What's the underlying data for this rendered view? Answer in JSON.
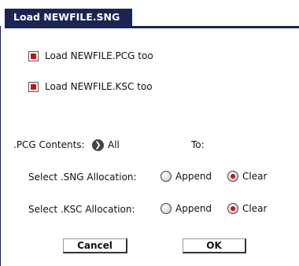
{
  "dialog": {
    "title": "Load NEWFILE.SNG"
  },
  "options": [
    {
      "label": "Load NEWFILE.PCG too",
      "checked": true
    },
    {
      "label": "Load NEWFILE.KSC too",
      "checked": true
    }
  ],
  "pcg": {
    "label": ".PCG Contents:",
    "value": "All",
    "to_label": "To:"
  },
  "sng_alloc": {
    "label": "Select .SNG Allocation:",
    "append_label": "Append",
    "clear_label": "Clear",
    "selected": "Clear"
  },
  "ksc_alloc": {
    "label": "Select .KSC Allocation:",
    "append_label": "Append",
    "clear_label": "Clear",
    "selected": "Clear"
  },
  "buttons": {
    "cancel": "Cancel",
    "ok": "OK"
  },
  "colors": {
    "title_bg": "#1b2554",
    "check_red": "#cc1111"
  },
  "icons": {
    "pcg_arrow": "arrow-right-circle-icon"
  }
}
